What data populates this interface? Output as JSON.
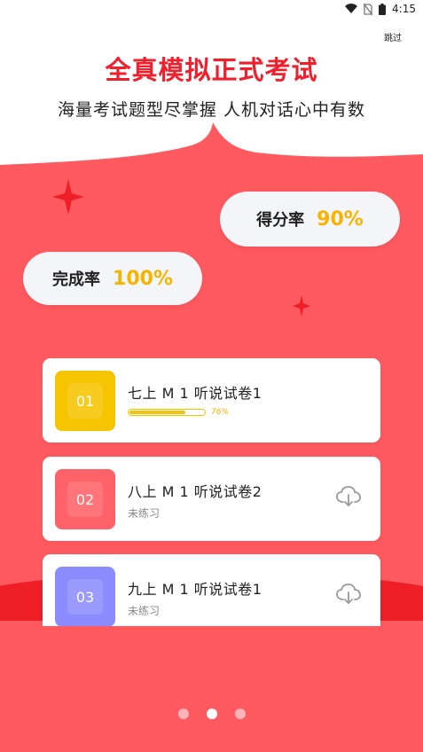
{
  "status_bar": {
    "time": "4:15",
    "icons": [
      "wifi-icon",
      "no-sim-icon",
      "battery-icon"
    ]
  },
  "skip_label": "跳过",
  "headline": "全真模拟正式考试",
  "subline": "海量考试题型尽掌握  人机对话心中有数",
  "stats": {
    "score": {
      "label": "得分率",
      "value": "90%"
    },
    "completion": {
      "label": "完成率",
      "value": "100%"
    }
  },
  "papers": [
    {
      "index": "01",
      "title": "七上 M 1 听说试卷1",
      "progress": 0.76,
      "progress_label": "76%",
      "color": "#f6c400"
    },
    {
      "index": "02",
      "title": "八上 M 1 听说试卷2",
      "status": "未练习",
      "color": "#ff6268",
      "icon": "cloud-download-icon"
    },
    {
      "index": "03",
      "title": "九上 M 1 听说试卷1",
      "status": "未练习",
      "color": "#8c8cff",
      "icon": "cloud-download-icon"
    }
  ],
  "pager": {
    "count": 3,
    "active": 1
  },
  "colors": {
    "accent_red": "#ef1f2c",
    "panel_red": "#ff5a5f",
    "gold": "#f6b400"
  }
}
